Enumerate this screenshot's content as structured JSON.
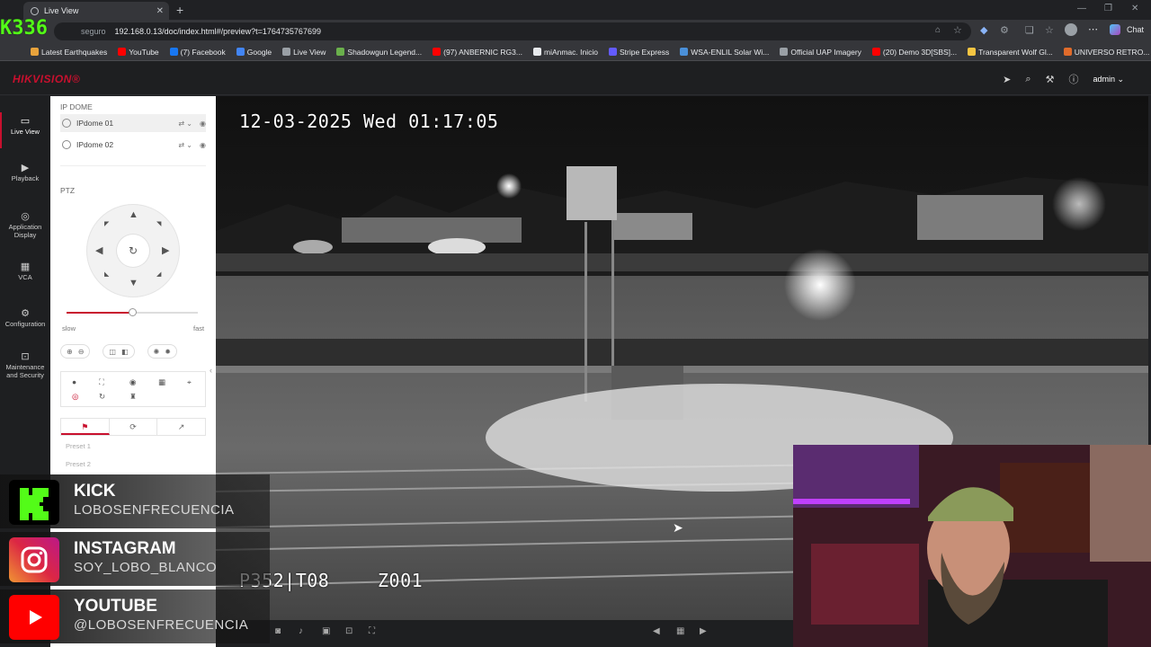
{
  "browser": {
    "tab_title": "Live View",
    "url_prefix": "seguro",
    "url": "192.168.0.13/doc/index.html#/preview?t=1764735767699",
    "chat_label": "Chat",
    "bookmarks": [
      {
        "label": "Latest Earthquakes",
        "color": "#e8a33c"
      },
      {
        "label": "YouTube",
        "color": "#ff0000"
      },
      {
        "label": "(7) Facebook",
        "color": "#1877f2"
      },
      {
        "label": "Google",
        "color": "#4285f4"
      },
      {
        "label": "Live View",
        "color": "#9aa0a6"
      },
      {
        "label": "Shadowgun Legend...",
        "color": "#6ab04c"
      },
      {
        "label": "(97) ANBERNIC RG3...",
        "color": "#ff0000"
      },
      {
        "label": "miAnmac. Inicio",
        "color": "#e8eaed"
      },
      {
        "label": "Stripe Express",
        "color": "#635bff"
      },
      {
        "label": "WSA-ENLIL Solar Wi...",
        "color": "#4a90d9"
      },
      {
        "label": "Official UAP Imagery",
        "color": "#9aa0a6"
      },
      {
        "label": "(20) Demo 3D[SBS]...",
        "color": "#ff0000"
      },
      {
        "label": "Transparent Wolf Gl...",
        "color": "#f5c542"
      },
      {
        "label": "UNIVERSO RETRO...",
        "color": "#e06b2b"
      }
    ]
  },
  "app": {
    "logo": "HIKVISION®",
    "user": "admin"
  },
  "nav": [
    {
      "label": "Live View",
      "icon": "▭"
    },
    {
      "label": "Playback",
      "icon": "▶"
    },
    {
      "label": "Application Display",
      "icon": "◎"
    },
    {
      "label": "VCA",
      "icon": "▦"
    },
    {
      "label": "Configuration",
      "icon": "⚙"
    },
    {
      "label": "Maintenance and Security",
      "icon": "⊡"
    }
  ],
  "panel": {
    "section_ipdome": "IP DOME",
    "cameras": [
      "IPdome 01",
      "IPdome 02"
    ],
    "section_ptz": "PTZ",
    "speed_slow": "slow",
    "speed_fast": "fast",
    "speed_level": 0.5,
    "presets": [
      "Preset 1",
      "Preset 2"
    ]
  },
  "video": {
    "timestamp": "12-03-2025 Wed 01:17:05",
    "osd_left": "P352|T08",
    "osd_right": "Z001"
  },
  "stream": {
    "badge": "K336",
    "socials": [
      {
        "platform": "KICK",
        "handle": "LOBOSENFRECUENCIA",
        "icon": "kick-icon",
        "color": "#000000"
      },
      {
        "platform": "INSTAGRAM",
        "handle": "SOY_LOBO_BLANCO",
        "icon": "instagram-icon",
        "color": "#d6249f"
      },
      {
        "platform": "YOUTUBE",
        "handle": "@LOBOSENFRECUENCIA",
        "icon": "youtube-icon",
        "color": "#ff0000"
      }
    ]
  }
}
